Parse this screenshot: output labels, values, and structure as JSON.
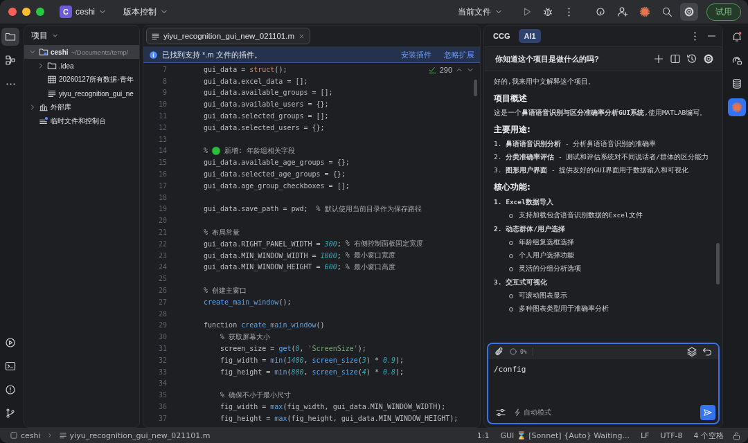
{
  "title_bar": {
    "project_badge": "C",
    "project": "ceshi",
    "vcs": "版本控制",
    "run_config": "当前文件",
    "trial_button": "试用"
  },
  "left_tool_strip": [
    {
      "selected": true
    },
    {
      "selected": false
    },
    {
      "selected": false
    }
  ],
  "project_panel": {
    "title": "项目",
    "tree": [
      {
        "label": "ceshi",
        "detail": "~/Documents/temp/",
        "kind": "module",
        "expanded": true,
        "selected": true,
        "children": [
          {
            "label": ".idea",
            "kind": "folder",
            "expanded": false,
            "selected": false
          },
          {
            "label": "20260127所有数据-青年",
            "kind": "table",
            "selected": false
          },
          {
            "label": "yiyu_recognition_gui_ne",
            "kind": "mfile",
            "selected": false
          }
        ]
      },
      {
        "label": "外部库",
        "kind": "library",
        "expanded": false,
        "selected": false
      },
      {
        "label": "临时文件和控制台",
        "kind": "scratch",
        "selected": false
      }
    ]
  },
  "editor": {
    "tabs": [
      {
        "label": "yiyu_recognition_gui_new_021101.m",
        "selected": true
      }
    ],
    "notification": {
      "text": "已找到支持 *.m 文件的插件。",
      "actions": [
        "安装插件",
        "忽略扩展"
      ]
    },
    "inspections": "290",
    "lines": [
      {
        "number": "7",
        "segments": [
          {
            "kind": "plain",
            "text": "gui_data = "
          },
          {
            "kind": "builtin",
            "text": "struct"
          },
          {
            "kind": "plain",
            "text": "();"
          }
        ]
      },
      {
        "number": "8",
        "segments": [
          {
            "kind": "plain",
            "text": "gui_data.excel_data = [];"
          }
        ]
      },
      {
        "number": "9",
        "segments": [
          {
            "kind": "plain",
            "text": "gui_data.available_groups = [];"
          }
        ]
      },
      {
        "number": "10",
        "segments": [
          {
            "kind": "plain",
            "text": "gui_data.available_users = {};"
          }
        ]
      },
      {
        "number": "11",
        "segments": [
          {
            "kind": "plain",
            "text": "gui_data.selected_groups = [];"
          }
        ]
      },
      {
        "number": "12",
        "segments": [
          {
            "kind": "plain",
            "text": "gui_data.selected_users = {};"
          }
        ]
      },
      {
        "number": "13"
      },
      {
        "number": "14",
        "segments": [
          {
            "kind": "comment",
            "text": "%"
          },
          {
            "kind": "dot"
          },
          {
            "kind": "comment",
            "text": "新增: 年龄组相关字段"
          }
        ]
      },
      {
        "number": "15",
        "segments": [
          {
            "kind": "plain",
            "text": "gui_data.available_age_groups = {};"
          }
        ]
      },
      {
        "number": "16",
        "segments": [
          {
            "kind": "plain",
            "text": "gui_data.selected_age_groups = {};"
          }
        ]
      },
      {
        "number": "17",
        "segments": [
          {
            "kind": "plain",
            "text": "gui_data.age_group_checkboxes = [];"
          }
        ]
      },
      {
        "number": "18"
      },
      {
        "number": "19",
        "segments": [
          {
            "kind": "plain",
            "text": "gui_data.save_path = pwd;  "
          },
          {
            "kind": "comment",
            "text": "% 默认使用当前目录作为保存路径"
          }
        ]
      },
      {
        "number": "20"
      },
      {
        "number": "21",
        "segments": [
          {
            "kind": "comment",
            "text": "% 布局常量"
          }
        ]
      },
      {
        "number": "22",
        "segments": [
          {
            "kind": "plain",
            "text": "gui_data.RIGHT_PANEL_WIDTH = "
          },
          {
            "kind": "number",
            "text": "300"
          },
          {
            "kind": "plain",
            "text": "; "
          },
          {
            "kind": "comment",
            "text": "% 右侧控制面板固定宽度"
          }
        ]
      },
      {
        "number": "23",
        "segments": [
          {
            "kind": "plain",
            "text": "gui_data.MIN_WINDOW_WIDTH = "
          },
          {
            "kind": "number",
            "text": "1000"
          },
          {
            "kind": "plain",
            "text": "; "
          },
          {
            "kind": "comment",
            "text": "% 最小窗口宽度"
          }
        ]
      },
      {
        "number": "24",
        "segments": [
          {
            "kind": "plain",
            "text": "gui_data.MIN_WINDOW_HEIGHT = "
          },
          {
            "kind": "number",
            "text": "600"
          },
          {
            "kind": "plain",
            "text": "; "
          },
          {
            "kind": "comment",
            "text": "% 最小窗口高度"
          }
        ]
      },
      {
        "number": "25"
      },
      {
        "number": "26",
        "segments": [
          {
            "kind": "comment",
            "text": "% 创建主窗口"
          }
        ]
      },
      {
        "number": "27",
        "segments": [
          {
            "kind": "func",
            "text": "create_main_window"
          },
          {
            "kind": "plain",
            "text": "();"
          }
        ]
      },
      {
        "number": "28"
      },
      {
        "number": "29",
        "segments": [
          {
            "kind": "plain",
            "text": "function "
          },
          {
            "kind": "func",
            "text": "create_main_window"
          },
          {
            "kind": "plain",
            "text": "()"
          }
        ]
      },
      {
        "number": "30",
        "segments": [
          {
            "kind": "comment",
            "text": "    % 获取屏幕大小"
          }
        ]
      },
      {
        "number": "31",
        "segments": [
          {
            "kind": "plain",
            "text": "    screen_size = "
          },
          {
            "kind": "func",
            "text": "get"
          },
          {
            "kind": "plain",
            "text": "("
          },
          {
            "kind": "number",
            "text": "0"
          },
          {
            "kind": "plain",
            "text": ", "
          },
          {
            "kind": "string",
            "text": "'ScreenSize'"
          },
          {
            "kind": "plain",
            "text": ");"
          }
        ]
      },
      {
        "number": "32",
        "segments": [
          {
            "kind": "plain",
            "text": "    fig_width = "
          },
          {
            "kind": "func",
            "text": "min"
          },
          {
            "kind": "plain",
            "text": "("
          },
          {
            "kind": "number",
            "text": "1400"
          },
          {
            "kind": "plain",
            "text": ", "
          },
          {
            "kind": "func",
            "text": "screen_size"
          },
          {
            "kind": "plain",
            "text": "("
          },
          {
            "kind": "number",
            "text": "3"
          },
          {
            "kind": "plain",
            "text": ") * "
          },
          {
            "kind": "number",
            "text": "0.9"
          },
          {
            "kind": "plain",
            "text": ");"
          }
        ]
      },
      {
        "number": "33",
        "segments": [
          {
            "kind": "plain",
            "text": "    fig_height = "
          },
          {
            "kind": "func",
            "text": "min"
          },
          {
            "kind": "plain",
            "text": "("
          },
          {
            "kind": "number",
            "text": "800"
          },
          {
            "kind": "plain",
            "text": ", "
          },
          {
            "kind": "func",
            "text": "screen_size"
          },
          {
            "kind": "plain",
            "text": "("
          },
          {
            "kind": "number",
            "text": "4"
          },
          {
            "kind": "plain",
            "text": ") * "
          },
          {
            "kind": "number",
            "text": "0.8"
          },
          {
            "kind": "plain",
            "text": ");"
          }
        ]
      },
      {
        "number": "34"
      },
      {
        "number": "35",
        "segments": [
          {
            "kind": "comment",
            "text": "    % 确保不小于最小尺寸"
          }
        ]
      },
      {
        "number": "36",
        "segments": [
          {
            "kind": "plain",
            "text": "    fig_width = "
          },
          {
            "kind": "func",
            "text": "max"
          },
          {
            "kind": "plain",
            "text": "(fig_width, gui_data.MIN_WINDOW_WIDTH);"
          }
        ]
      },
      {
        "number": "37",
        "segments": [
          {
            "kind": "plain",
            "text": "    fig_height = "
          },
          {
            "kind": "func",
            "text": "max"
          },
          {
            "kind": "plain",
            "text": "(fig_height, gui_data.MIN_WINDOW_HEIGHT);"
          }
        ]
      }
    ]
  },
  "chat": {
    "tabs": [
      {
        "label": "CCG",
        "selected": false
      },
      {
        "label": "AI1",
        "selected": true
      }
    ],
    "question": "你知道这个项目是做什么的吗?",
    "blocks": [
      {
        "kind": "para",
        "text": "好的,我来用中文解释这个项目。"
      },
      {
        "kind": "heading",
        "text": "项目概述"
      },
      {
        "kind": "para",
        "text": "这是一个**鼻语语音识别与区分准确率分析GUI系统**,使用MATLAB编写。"
      },
      {
        "kind": "heading",
        "text": "主要用途:"
      },
      {
        "kind": "item",
        "text": "1. **鼻语语音识别分析** - 分析鼻语语音识别的准确率"
      },
      {
        "kind": "item",
        "text": "2. **分类准确率评估** - 测试和评估系统对不同说话者/群体的区分能力"
      },
      {
        "kind": "item",
        "text": "3. **图形用户界面** - 提供友好的GUI界面用于数据输入和可视化"
      },
      {
        "kind": "heading",
        "text": "核心功能:"
      },
      {
        "kind": "subheading",
        "text": "1. Excel数据导入"
      },
      {
        "kind": "bullet",
        "text": "支持加载包含语音识别数据的Excel文件"
      },
      {
        "kind": "subheading",
        "text": "2. 动态群体/用户选择"
      },
      {
        "kind": "bullet",
        "text": "年龄组复选框选择"
      },
      {
        "kind": "bullet",
        "text": "个人用户选择功能"
      },
      {
        "kind": "bullet",
        "text": "灵活的分组分析选项"
      },
      {
        "kind": "subheading",
        "text": "3. 交互式可视化"
      },
      {
        "kind": "bullet",
        "text": "可滚动图表显示"
      },
      {
        "kind": "bullet",
        "text": "多种图表类型用于准确率分析"
      }
    ],
    "input": {
      "context_percent": "0%",
      "value": "/config",
      "mode": "自动模式"
    }
  },
  "right_tool_strip": [
    {
      "selected": false
    },
    {
      "selected": false
    },
    {
      "selected": false
    },
    {
      "selected": true
    }
  ],
  "status_bar": {
    "project": "ceshi",
    "file": "yiyu_recognition_gui_new_021101.m",
    "position": "1:1",
    "ai_status": "GUI ⌛ [Sonnet] {Auto} Waiting...",
    "line_ending": "LF",
    "encoding": "UTF-8",
    "indent": "4 个空格"
  }
}
